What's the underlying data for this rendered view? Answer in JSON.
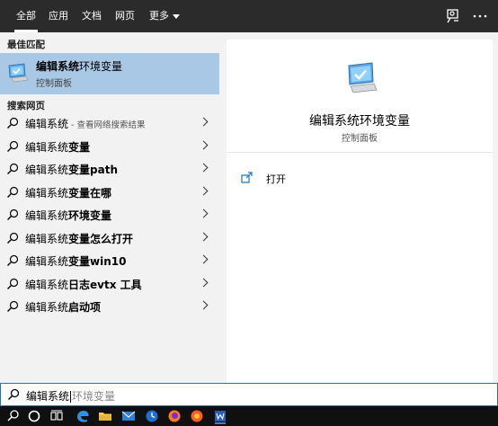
{
  "topbar": {
    "tabs": [
      {
        "label": "全部",
        "active": true
      },
      {
        "label": "应用",
        "active": false
      },
      {
        "label": "文档",
        "active": false
      },
      {
        "label": "网页",
        "active": false
      },
      {
        "label": "更多",
        "active": false
      }
    ],
    "icons": [
      "feedback-icon",
      "more-options-icon"
    ]
  },
  "left": {
    "best_match_label": "最佳匹配",
    "best": {
      "title_bold": "编辑系统",
      "title_rest": "环境变量",
      "subtitle": "控制面板",
      "icon": "monitor-check-icon"
    },
    "web_label": "搜索网页",
    "rows": [
      {
        "plain": "编辑系统",
        "bold": "",
        "hint": " - 查看网络搜索结果"
      },
      {
        "plain": "编辑系统",
        "bold": "变量",
        "hint": ""
      },
      {
        "plain": "编辑系统",
        "bold": "变量path",
        "hint": ""
      },
      {
        "plain": "编辑系统",
        "bold": "变量在哪",
        "hint": ""
      },
      {
        "plain": "编辑系统",
        "bold": "环境变量",
        "hint": ""
      },
      {
        "plain": "编辑系统",
        "bold": "变量怎么打开",
        "hint": ""
      },
      {
        "plain": "编辑系统",
        "bold": "变量win10",
        "hint": ""
      },
      {
        "plain": "编辑系统",
        "bold": "日志evtx 工具",
        "hint": ""
      },
      {
        "plain": "编辑系统",
        "bold": "启动项",
        "hint": ""
      }
    ]
  },
  "right": {
    "title": "编辑系统环境变量",
    "subtitle": "控制面板",
    "action_label": "打开"
  },
  "search": {
    "typed": "编辑系统",
    "completion": "环境变量"
  },
  "taskbar": {
    "icons": [
      "search-icon",
      "cortana-icon",
      "task-view-icon",
      "edge-icon",
      "file-explorer-icon",
      "mail-icon",
      "clock-app-icon",
      "firefox-icon",
      "firefox-alt-icon",
      "word-icon"
    ]
  },
  "colors": {
    "topbar": "#2b2b2b",
    "selected": "#a9c8e6",
    "accent": "#1a73c8"
  }
}
